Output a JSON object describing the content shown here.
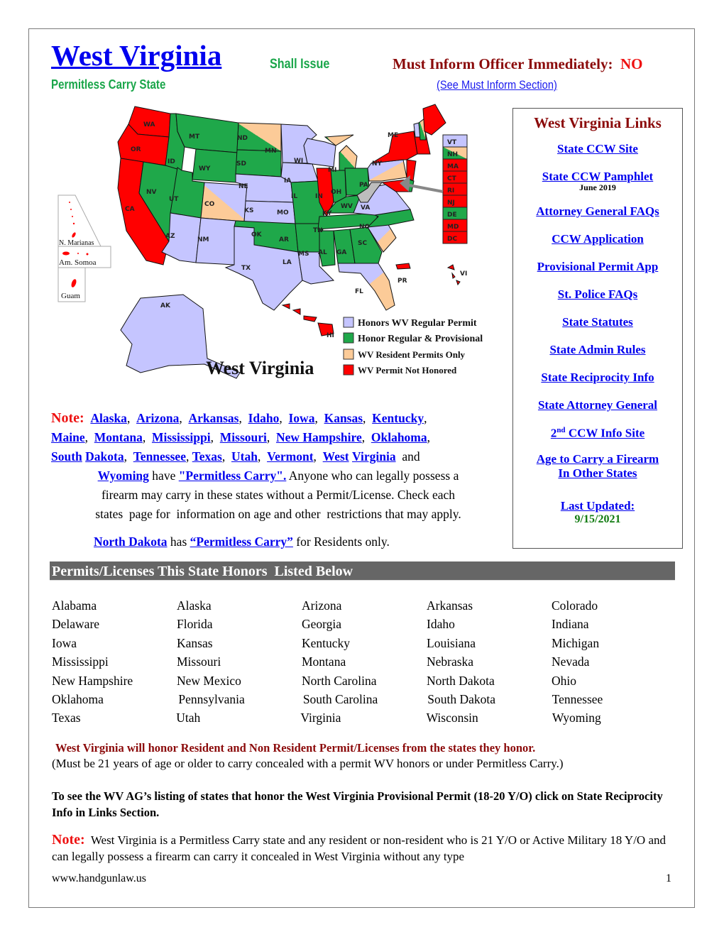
{
  "header": {
    "title": "West Virginia",
    "issue_type": "Shall Issue",
    "inform_label": "Must Inform Officer Immediately:",
    "inform_value": "NO",
    "subtitle": "Permitless Carry State",
    "see_inform_link": "(See Must Inform Section)"
  },
  "colors": {
    "honors_regular": "#c5c5ff",
    "honor_regular_provisional": "#1fa84a",
    "resident_only": "#fccb98",
    "not_honored": "#ff0000",
    "home_state": "#bdbdbd",
    "link": "#0000ee",
    "title_dark_red": "#8b0a0a",
    "green_text": "#1aa64a",
    "section_header_bg": "#666666"
  },
  "links_box": {
    "title": "West Virginia Links",
    "links": [
      {
        "label": "State CCW Site"
      },
      {
        "label": "State CCW Pamphlet",
        "note": "June 2019"
      },
      {
        "label": "Attorney General FAQs"
      },
      {
        "label": "CCW Application"
      },
      {
        "label": "Provisional Permit App"
      },
      {
        "label": "St. Police FAQs"
      },
      {
        "label": "State Statutes"
      },
      {
        "label": "State Admin Rules"
      },
      {
        "label": "State Reciprocity Info"
      },
      {
        "label": "State Attorney General"
      },
      {
        "label_sup": "nd",
        "label_pre": "2",
        "label_post": " CCW Info Site"
      },
      {
        "label_line1": "Age to Carry a Firearm",
        "label_line2": "In Other States"
      }
    ],
    "last_updated_label": "Last Updated:",
    "last_updated_value": "9/15/2021"
  },
  "map": {
    "title": "West Virginia",
    "legend": [
      {
        "label": "Honors WV Regular Permit",
        "color_key": "honors_regular"
      },
      {
        "label": "Honor Regular & Provisional",
        "color_key": "honor_regular_provisional"
      },
      {
        "label": "WV Resident Permits Only",
        "color_key": "resident_only"
      },
      {
        "label": "WV Permit Not Honored",
        "color_key": "not_honored"
      }
    ],
    "territories": [
      "N. Marianas",
      "Am. Somoa",
      "Guam"
    ],
    "small_labels": {
      "pr": "PR",
      "vi": "VI",
      "hi": "HI"
    },
    "northeast_box": [
      {
        "abbr": "VT",
        "status": "honors_regular"
      },
      {
        "abbr": "NH",
        "status": "split_green_peach"
      },
      {
        "abbr": "MA",
        "status": "not_honored"
      },
      {
        "abbr": "CT",
        "status": "not_honored"
      },
      {
        "abbr": "RI",
        "status": "not_honored"
      },
      {
        "abbr": "NJ",
        "status": "not_honored"
      },
      {
        "abbr": "DE",
        "status": "honor_regular_provisional"
      },
      {
        "abbr": "MD",
        "status": "not_honored"
      },
      {
        "abbr": "DC",
        "status": "not_honored"
      }
    ],
    "states": {
      "WA": "not_honored",
      "OR": "not_honored",
      "CA": "not_honored",
      "NV": "honor_regular_provisional",
      "ID": "honor_regular_provisional",
      "MT": "honor_regular_provisional",
      "WY": "honor_regular_provisional",
      "UT": "honor_regular_provisional",
      "AZ": "honors_regular",
      "NM": "honors_regular",
      "CO": "split_lavender_peach",
      "ND": "split_green_peach",
      "SD": "honor_regular_provisional",
      "NE": "honors_regular",
      "KS": "honors_regular",
      "OK": "honor_regular_provisional",
      "TX": "honors_regular",
      "MN": "honors_regular",
      "IA": "honors_regular",
      "MO": "honor_regular_provisional",
      "AR": "honor_regular_provisional",
      "LA": "honors_regular",
      "WI": "honors_regular",
      "IL": "not_honored",
      "MI": "split_green_peach",
      "IN": "honor_regular_provisional",
      "OH": "honor_regular_provisional",
      "KY": "honor_regular_provisional",
      "TN": "honor_regular_provisional",
      "MS": "honor_regular_provisional",
      "AL": "honor_regular_provisional",
      "GA": "honor_regular_provisional",
      "FL": "split_lavender_peach",
      "SC": "split_lavender_peach",
      "NC": "honor_regular_provisional",
      "VA": "honors_regular",
      "WV": "home_state",
      "PA": "split_lavender_peach",
      "NY": "not_honored",
      "ME": "not_honored",
      "AK": "honors_regular",
      "HI": "not_honored"
    }
  },
  "note_section": {
    "label": "Note:",
    "states": [
      "Alaska",
      "Arizona",
      "Arkansas",
      "Idaho",
      "Iowa",
      "Kansas",
      "Kentucky",
      "Maine",
      "Montana",
      "Mississippi",
      "Missouri",
      "New Hampshire",
      "Oklahoma",
      "South",
      "Dakota",
      "Tennessee",
      "Texas",
      "Utah",
      "Vermont",
      "West",
      "Virginia"
    ],
    "and_word": "and",
    "last_state": "Wyoming",
    "have_text": "have",
    "permitless_link": "\"Permitless Carry\".",
    "body_text_1": " Anyone who can legally possess a",
    "body_text_2": "firearm may carry in these states without a Permit/License. Check each",
    "body_text_3": "states  page for  information on age and other  restrictions that may apply.",
    "nd_state": "North Dakota",
    "nd_has": " has ",
    "nd_link": "“Permitless Carry”",
    "nd_tail": " for Residents only."
  },
  "honors_section": {
    "header": "Permits/Licenses This State Honors  Listed Below",
    "rows": [
      [
        "Alabama",
        "Alaska",
        "Arizona",
        "Arkansas",
        "Colorado"
      ],
      [
        "Delaware",
        "Florida",
        "Georgia",
        "Idaho",
        "Indiana"
      ],
      [
        "Iowa",
        "Kansas",
        "Kentucky",
        "Louisiana",
        "Michigan"
      ],
      [
        "Mississippi",
        "Missouri",
        "Montana",
        "Nebraska",
        "Nevada"
      ],
      [
        "New Hampshire",
        "New Mexico",
        "North Carolina",
        "North Dakota",
        "Ohio"
      ],
      [
        "Oklahoma",
        "Pennsylvania",
        "South Carolina",
        "South Dakota",
        "Tennessee"
      ],
      [
        "Texas",
        "Utah",
        "Virginia",
        "Wisconsin",
        "Wyoming"
      ]
    ]
  },
  "body": {
    "honor_statement": "West Virginia will honor Resident and Non Resident Permit/Licenses from the states they honor.",
    "age_statement": "(Must be 21 years of age or older to carry concealed with a permit WV honors or under Permitless Carry.)",
    "ag_statement": "To see the WV AG’s listing of states that honor the West Virginia Provisional Permit (18-20 Y/O) click on State Reciprocity Info in Links Section.",
    "final_note_label": "Note:",
    "final_note": "  West Virginia is a Permitless Carry state and any resident or non-resident who is 21 Y/O or Active Military 18 Y/O and can legally possess a firearm can carry it concealed in West Virginia without any type"
  },
  "footer": {
    "url": "www.handgunlaw.us",
    "page": "1"
  }
}
